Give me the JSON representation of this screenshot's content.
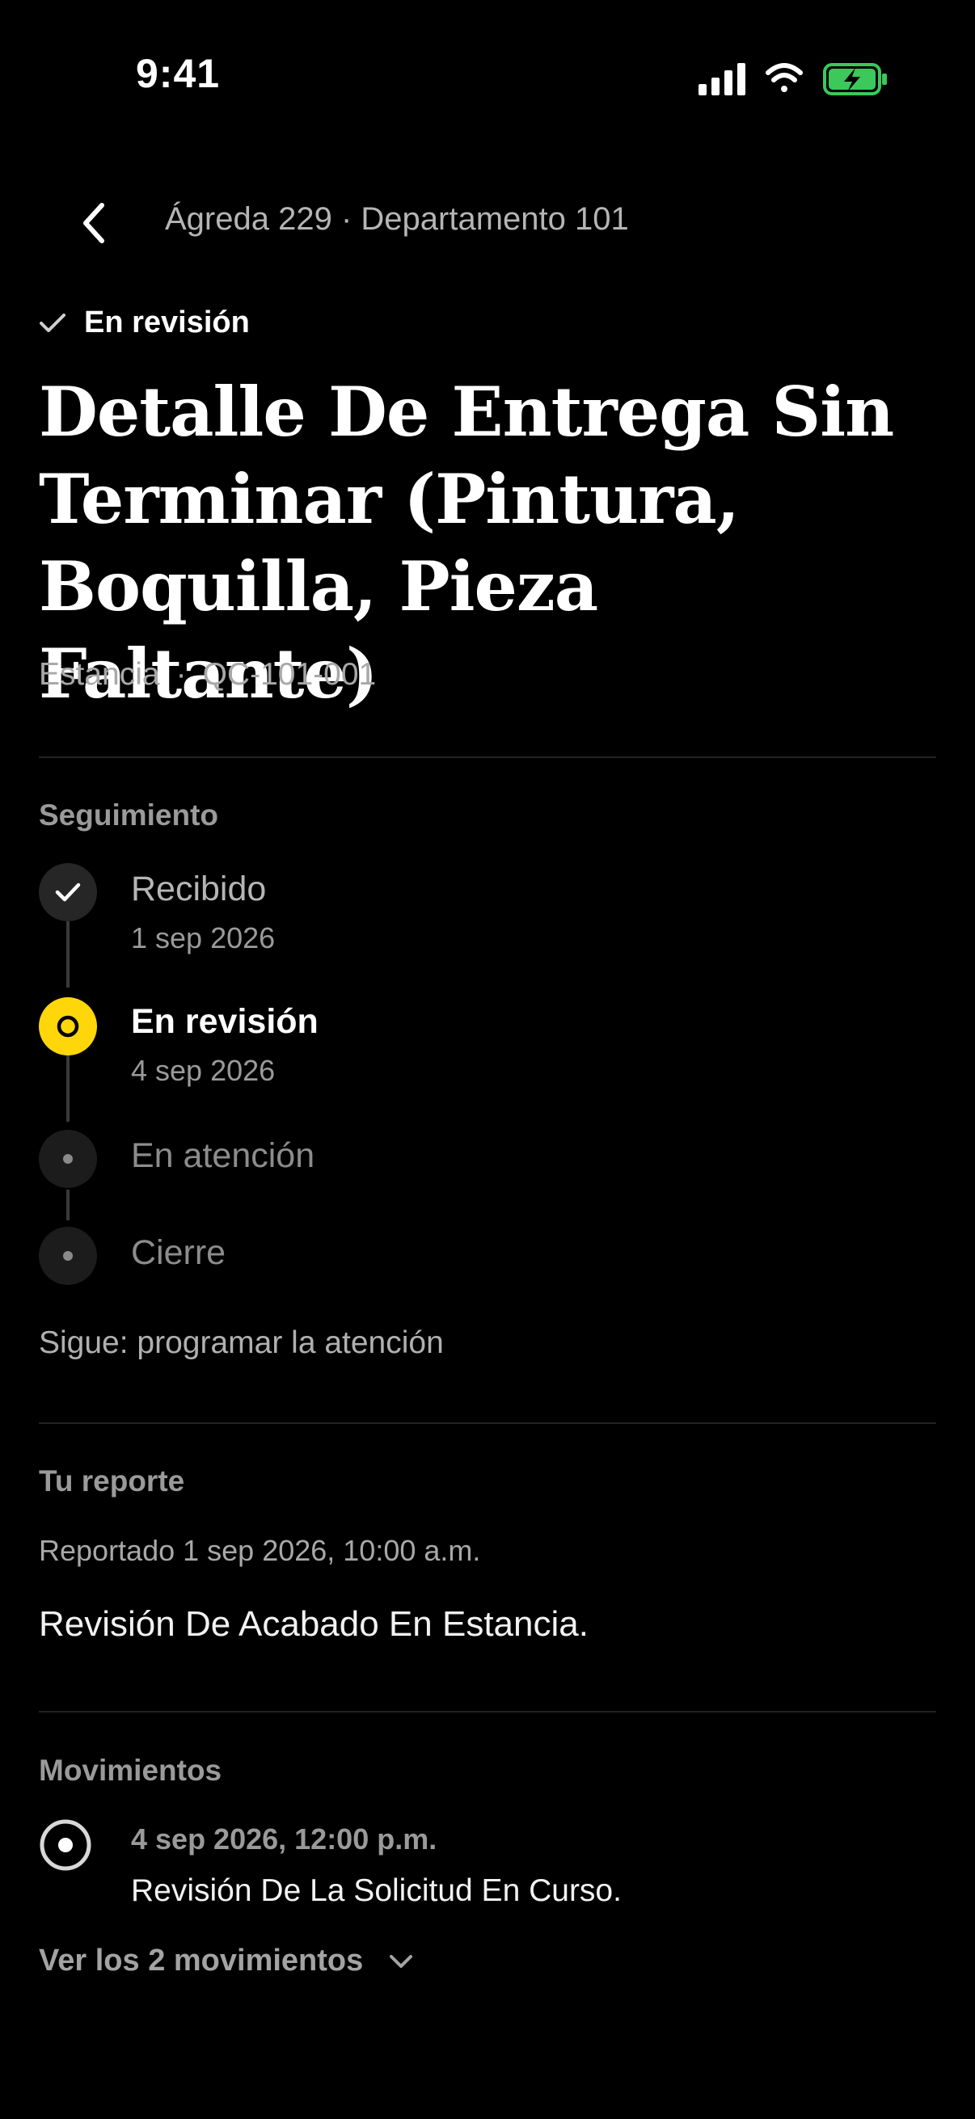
{
  "status_bar": {
    "time": "9:41",
    "battery_color": "#3cc85a"
  },
  "header": {
    "back_icon": "chevron-left-icon",
    "title": "Ágreda 229 · Departamento 101"
  },
  "status_tag": {
    "icon": "check-icon",
    "label": "En revisión"
  },
  "ticket": {
    "title": "Detalle De Entrega Sin Terminar (Pintura, Boquilla, Pieza Faltante)",
    "area": "Estancia",
    "separator": "·",
    "code": "QC-101-001"
  },
  "tracking": {
    "label": "Seguimiento",
    "accent_color": "#ffd60a",
    "steps": [
      {
        "label": "Recibido",
        "date": "1 sep 2026",
        "state": "done"
      },
      {
        "label": "En revisión",
        "date": "4 sep 2026",
        "state": "current"
      },
      {
        "label": "En atención",
        "date": "",
        "state": "pending"
      },
      {
        "label": "Cierre",
        "date": "",
        "state": "pending"
      }
    ],
    "next_step": "Sigue: programar la atención"
  },
  "report": {
    "label": "Tu reporte",
    "reported_at": "Reportado 1 sep 2026, 10:00 a.m.",
    "description": "Revisión De Acabado En Estancia."
  },
  "movements": {
    "label": "Movimientos",
    "items": [
      {
        "date": "4 sep 2026, 12:00 p.m.",
        "text": "Revisión De La Solicitud En Curso."
      }
    ],
    "show_more_label": "Ver los 2 movimientos",
    "show_more_icon": "chevron-down-icon"
  }
}
